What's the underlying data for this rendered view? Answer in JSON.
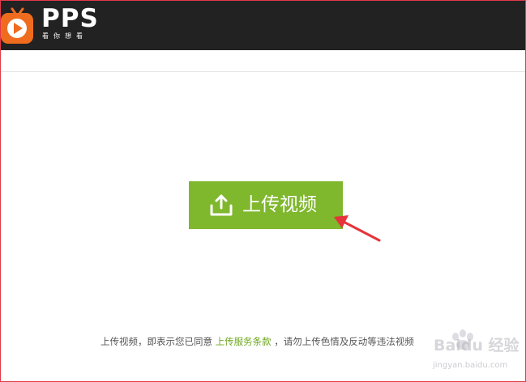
{
  "header": {
    "brand": "PPS",
    "slogan": "看你想看",
    "brand_color": "#ef6c1f"
  },
  "main": {
    "upload_button": {
      "label": "上传视频",
      "icon": "upload-icon",
      "color": "#7fb72d"
    }
  },
  "footer": {
    "terms_prefix": "上传视频，即表示您已同意 ",
    "terms_link": "上传服务条款",
    "terms_suffix": " ，请勿上传色情及反动等违法视频"
  },
  "watermark": {
    "text": "Baidu 经验",
    "site": "jingyan.baidu.com"
  }
}
